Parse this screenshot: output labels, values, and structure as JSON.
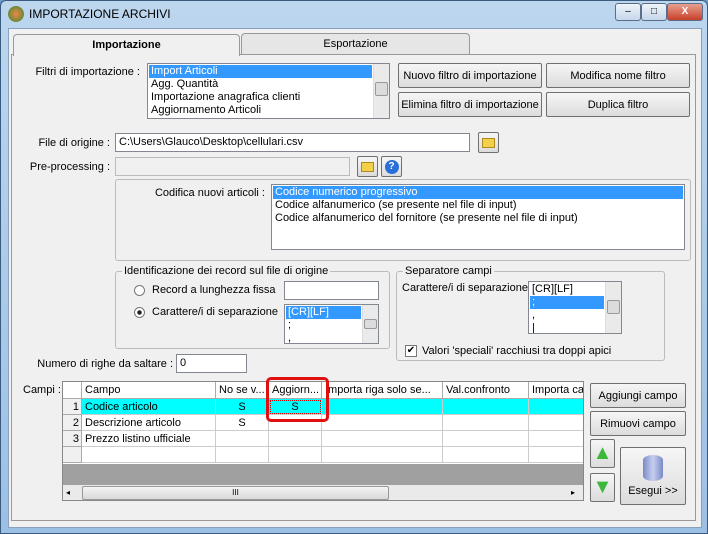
{
  "window": {
    "title": "IMPORTAZIONE ARCHIVI",
    "minimize": "–",
    "maximize": "□",
    "close": "X"
  },
  "tabs": [
    {
      "label": "Importazione",
      "active": true
    },
    {
      "label": "Esportazione",
      "active": false
    }
  ],
  "filters": {
    "label": "Filtri di importazione :",
    "items": [
      "Import Articoli",
      "Agg. Quantità",
      "Importazione anagrafica clienti",
      "Aggiornamento Articoli"
    ],
    "selected": "Import Articoli"
  },
  "buttons": {
    "new_filter": "Nuovo filtro di importazione",
    "rename_filter": "Modifica nome filtro",
    "delete_filter": "Elimina filtro di importazione",
    "duplicate_filter": "Duplica filtro",
    "add_field": "Aggiungi campo",
    "remove_field": "Rimuovi campo",
    "execute": "Esegui >>"
  },
  "source_file": {
    "label": "File di origine :",
    "value": "C:\\Users\\Glauco\\Desktop\\cellulari.csv"
  },
  "preprocessing": {
    "label": "Pre-processing :",
    "value": ""
  },
  "coding": {
    "label": "Codifica nuovi articoli :",
    "items": [
      "Codice numerico progressivo",
      "Codice alfanumerico (se presente nel file di input)",
      "Codice alfanumerico del fornitore (se presente nel file di input)"
    ],
    "selected": "Codice numerico progressivo"
  },
  "identification": {
    "title": "Identificazione dei record sul file di origine",
    "fixed_label": "Record a lunghezza fissa",
    "sep_label": "Carattere/i di separazione",
    "selected": "sep",
    "fixed_value": "",
    "sep_items": [
      "[CR][LF]",
      ";",
      ","
    ]
  },
  "separator": {
    "title": "Separatore campi",
    "label": "Carattere/i di separazione",
    "items": [
      "[CR][LF]",
      ";",
      ",",
      "|"
    ],
    "selected": ";",
    "quote_label": "Valori 'speciali' racchiusi tra doppi apici",
    "quote_checked": true
  },
  "skip_rows": {
    "label": "Numero di righe da saltare :",
    "value": "0"
  },
  "grid": {
    "label": "Campi :",
    "columns": [
      "Campo",
      "No se v...",
      "Aggiorn...",
      "Importa riga solo se...",
      "Val.confronto",
      "Importa ca"
    ],
    "rows": [
      {
        "n": "1",
        "cells": [
          "Codice articolo",
          "S",
          "S",
          "",
          "",
          ""
        ]
      },
      {
        "n": "2",
        "cells": [
          "Descrizione articolo",
          "S",
          "",
          "",
          "",
          ""
        ]
      },
      {
        "n": "3",
        "cells": [
          "Prezzo listino ufficiale",
          "",
          "",
          "",
          "",
          ""
        ]
      },
      {
        "n": "",
        "cells": [
          "",
          "",
          "",
          "",
          "",
          ""
        ]
      }
    ],
    "selected_row": 0,
    "hscroll_grip": "III"
  },
  "colors": {
    "selected_row": "#00ffff",
    "highlight": "#e01010",
    "list_selection": "#3399ff"
  }
}
